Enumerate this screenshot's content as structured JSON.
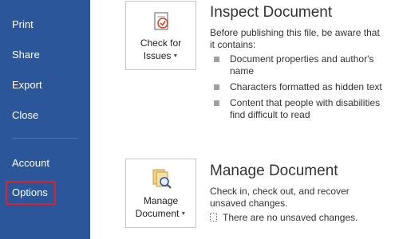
{
  "nav": {
    "items": [
      {
        "label": "Print"
      },
      {
        "label": "Share"
      },
      {
        "label": "Export"
      },
      {
        "label": "Close"
      },
      {
        "label": "Account"
      },
      {
        "label": "Options"
      }
    ]
  },
  "inspect": {
    "tile_line1": "Check for",
    "tile_line2": "Issues",
    "title": "Inspect Document",
    "description": "Before publishing this file, be aware that it contains:",
    "bullets": [
      "Document properties and author's name",
      "Characters formatted as hidden text",
      "Content that people with disabilities find difficult to read"
    ]
  },
  "manage": {
    "tile_line1": "Manage",
    "tile_line2": "Document",
    "title": "Manage Document",
    "description": "Check in, check out, and recover unsaved changes.",
    "status": "There are no unsaved changes."
  },
  "colors": {
    "nav_bg": "#2b579a",
    "highlight": "#d9232e",
    "page_bg": "#ffffff"
  },
  "icons": [
    "check-for-issues-icon",
    "manage-document-icon",
    "dropdown-caret-icon",
    "bullet-icon",
    "document-status-icon"
  ]
}
